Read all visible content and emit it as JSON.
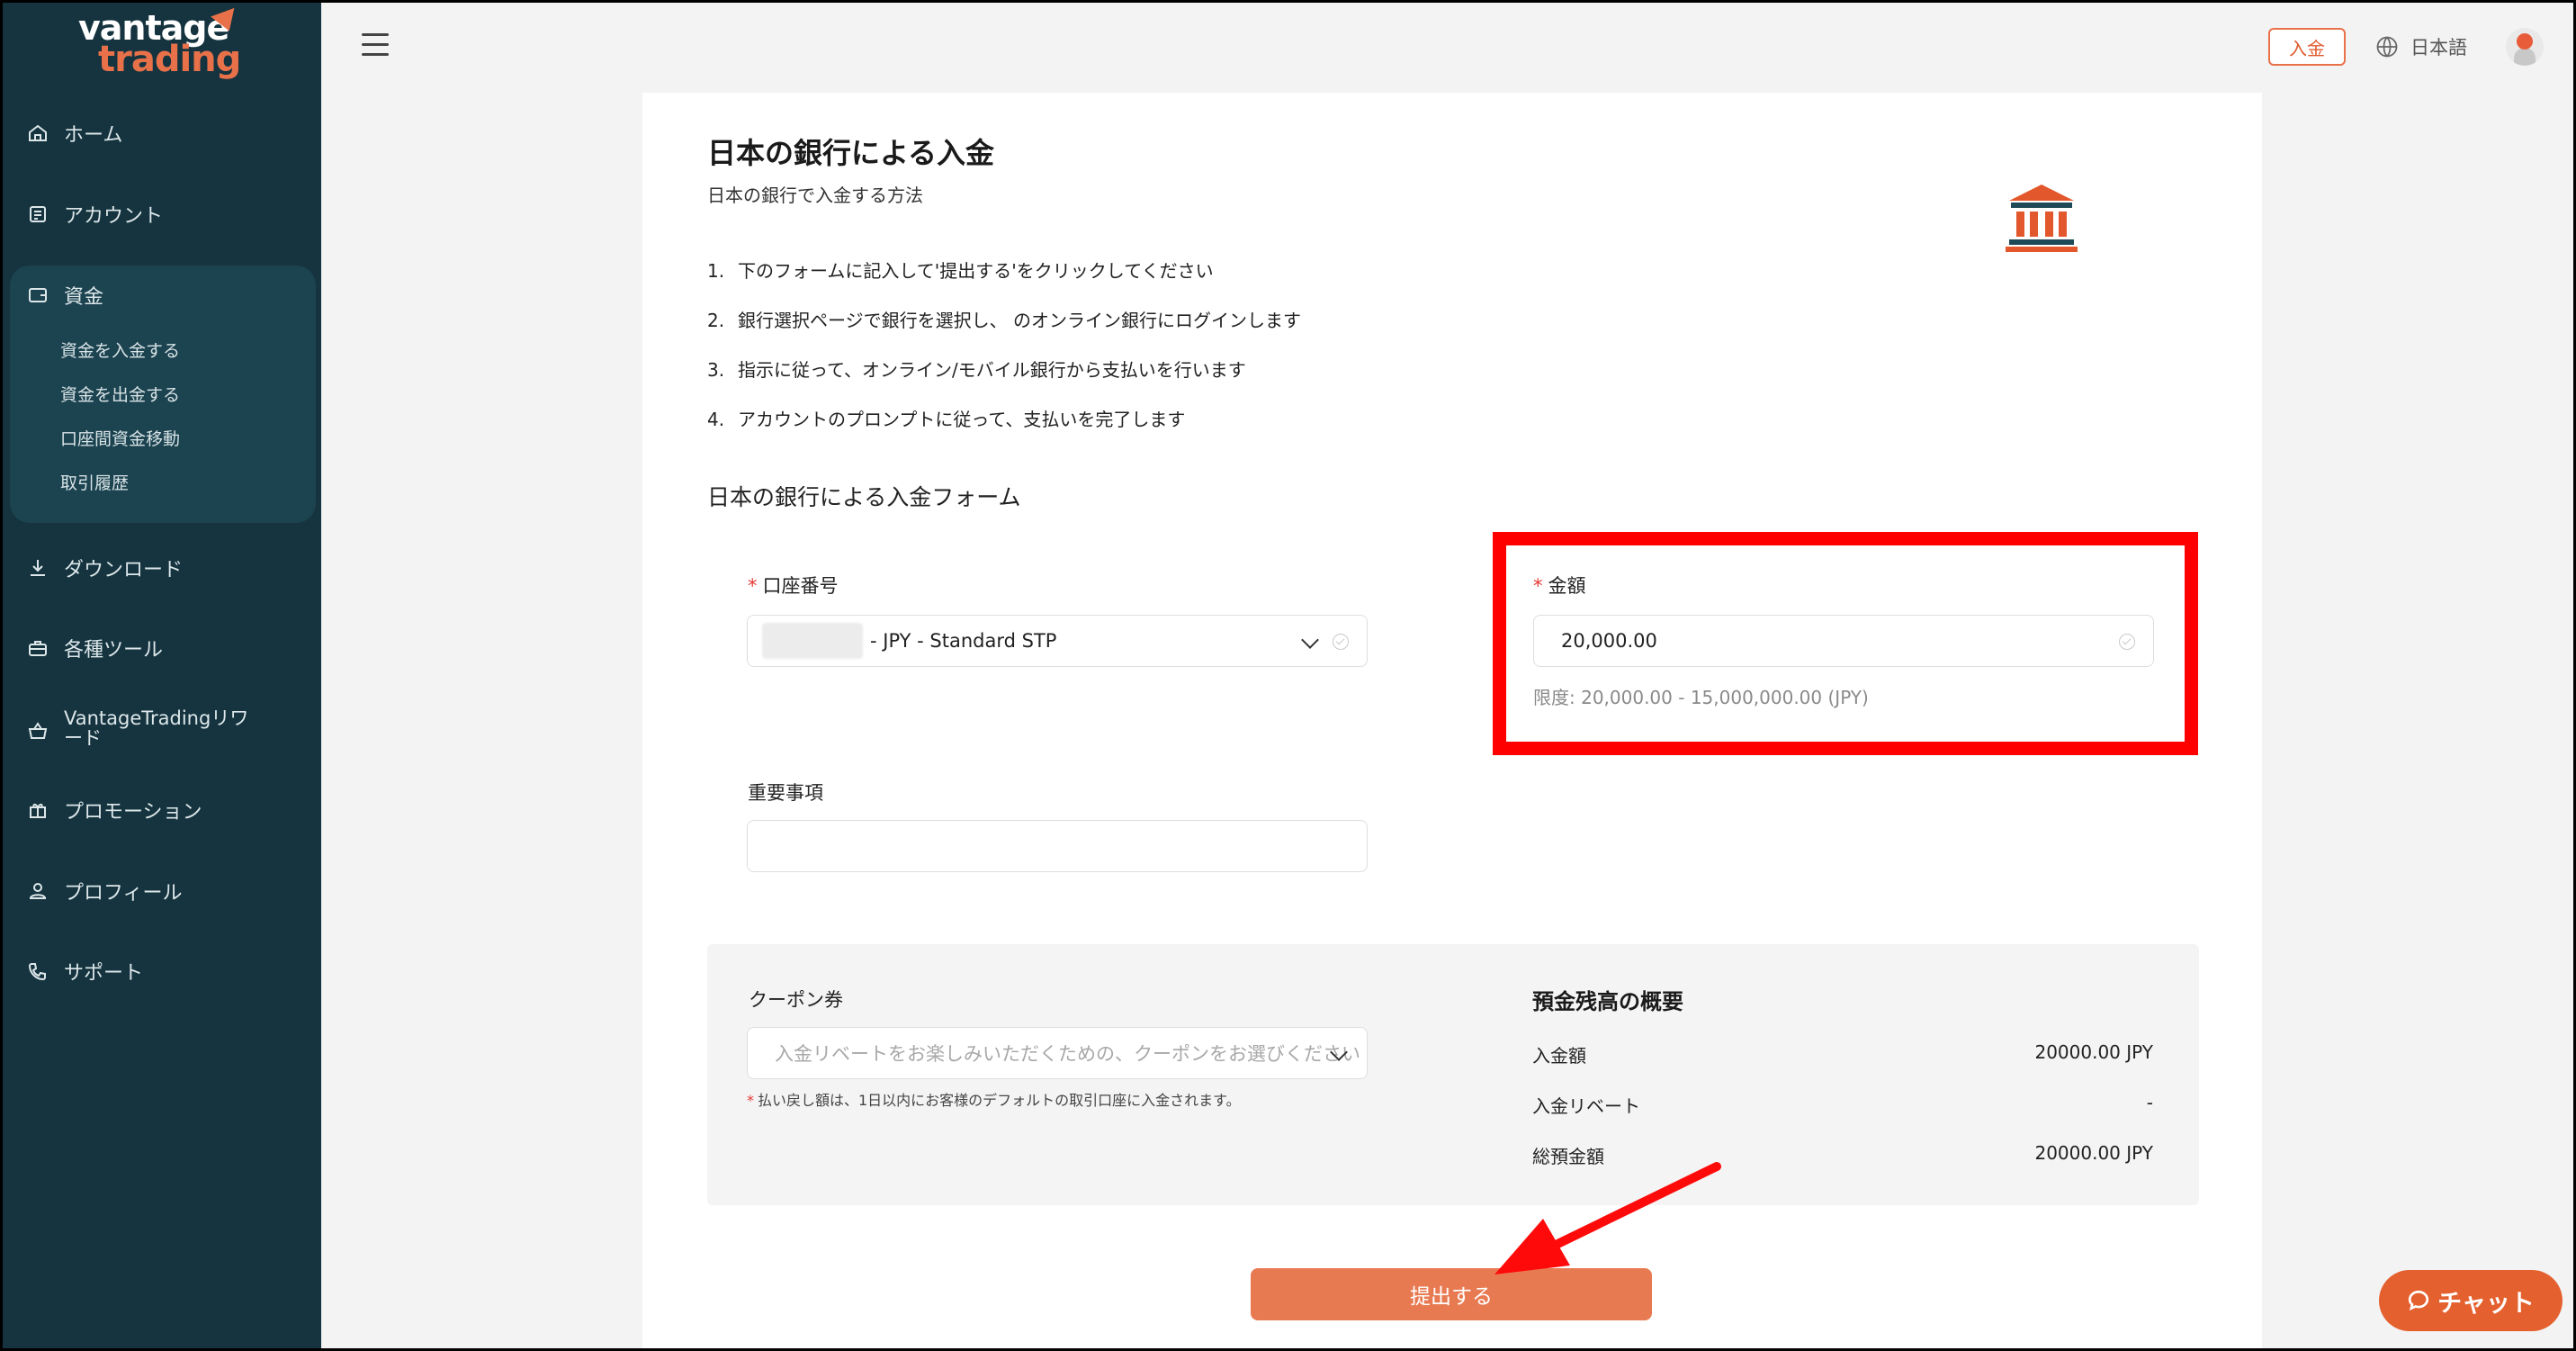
{
  "app": {
    "logo_top": "vantage",
    "logo_bottom": "trading"
  },
  "sidebar": {
    "items": [
      {
        "label": "ホーム",
        "icon": "home-icon"
      },
      {
        "label": "アカウント",
        "icon": "account-icon"
      },
      {
        "label": "資金",
        "icon": "wallet-icon"
      },
      {
        "label": "ダウンロード",
        "icon": "download-icon"
      },
      {
        "label": "各種ツール",
        "icon": "toolbox-icon"
      },
      {
        "label": "VantageTradingリワード",
        "icon": "basket-icon"
      },
      {
        "label": "プロモーション",
        "icon": "gift-icon"
      },
      {
        "label": "プロフィール",
        "icon": "profile-icon"
      },
      {
        "label": "サポート",
        "icon": "phone-icon"
      }
    ],
    "funds_subitems": [
      "資金を入金する",
      "資金を出金する",
      "口座間資金移動",
      "取引履歴"
    ]
  },
  "topbar": {
    "deposit_label": "入金",
    "language": "日本語"
  },
  "page": {
    "title": "日本の銀行による入金",
    "subtitle": "日本の銀行で入金する方法",
    "steps": [
      {
        "num": "1.",
        "text": "下のフォームに記入して'提出する'をクリックしてください"
      },
      {
        "num": "2.",
        "text": "銀行選択ページで銀行を選択し、 のオンライン銀行にログインします"
      },
      {
        "num": "3.",
        "text": "指示に従って、オンライン/モバイル銀行から支払いを行います"
      },
      {
        "num": "4.",
        "text": "アカウントのプロンプトに従って、支払いを完了します"
      }
    ],
    "form_title": "日本の銀行による入金フォーム"
  },
  "form": {
    "account_label": "口座番号",
    "account_value": "- JPY - Standard STP",
    "amount_label": "金額",
    "amount_value": "20,000.00",
    "amount_limit": "限度: 20,000.00 - 15,000,000.00 (JPY)",
    "notes_label": "重要事項",
    "notes_value": "",
    "required_mark": "*"
  },
  "coupon": {
    "label": "クーポン券",
    "placeholder": "入金リベートをお楽しみいただくための、クーポンをお選びください",
    "note": "払い戻し額は、1日以内にお客様のデフォルトの取引口座に入金されます。"
  },
  "summary": {
    "title": "預金残高の概要",
    "rows": [
      {
        "label": "入金額",
        "value": "20000.00 JPY"
      },
      {
        "label": "入金リベート",
        "value": "-"
      },
      {
        "label": "総預金額",
        "value": "20000.00 JPY"
      }
    ]
  },
  "actions": {
    "submit_label": "提出する",
    "chat_label": "チャット"
  },
  "colors": {
    "sidebar_bg": "#15343f",
    "accent": "#e8714a",
    "highlight": "#ff0000",
    "submit_bg": "#e87a52",
    "chat_bg": "#e4602e"
  }
}
